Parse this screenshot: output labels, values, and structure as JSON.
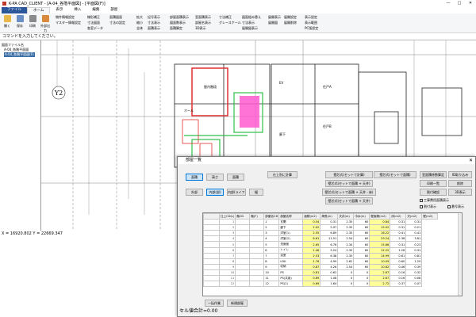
{
  "window": {
    "title": "K-PA CAD_CLIENT - [A-04_各階平面図] - [平面図(F)]",
    "controls": [
      "—",
      "□",
      "✕"
    ]
  },
  "tabs": [
    {
      "label": "ファイル",
      "type": "file"
    },
    {
      "label": "ホーム",
      "type": "active"
    },
    {
      "label": "表示",
      "type": "normal"
    },
    {
      "label": "挿入",
      "type": "normal"
    },
    {
      "label": "編集",
      "type": "normal"
    },
    {
      "label": "部屋",
      "type": "normal"
    }
  ],
  "ribbon": {
    "big_buttons": [
      "開く",
      "保存",
      "印刷",
      "外部出力"
    ],
    "small_buttons": [
      "物件情報設定",
      "マスター情報設定",
      "線形補正",
      "寸法図面",
      "各室データ",
      "面積図面",
      "寸法の設定",
      "拡大",
      "縮小",
      "全体",
      "記号表示",
      "寸法表示",
      "面積表示",
      "部屋面積表示",
      "図面数表示",
      "面積算定",
      "室面積表示",
      "部屋名表示",
      "3D表示",
      "グレースケール",
      "寸法補正",
      "図面組み替え",
      "寸法表示",
      "展開図表示",
      "展開表示",
      "展開図",
      "展開設定",
      "展開削除",
      "表示設定",
      "表示範囲",
      "PC版設定"
    ]
  },
  "command_bar": {
    "text": "コマンドを入力してください。"
  },
  "tree": {
    "items": [
      "図面ファイル名",
      "A-04_各階平面図",
      "A-04_各階平面図(F)"
    ]
  },
  "canvas": {
    "grid_label": "Y2",
    "room_labels": [
      "屋内階段",
      "EV",
      "住戸A",
      "住戸B",
      "ホール",
      "廊下"
    ]
  },
  "status": {
    "coords": "X = 16920.802 Y = 22669.347"
  },
  "dialog": {
    "title": "部屋一覧",
    "close": "✕",
    "mode_buttons": [
      "面積",
      "高さ",
      "面積"
    ],
    "type_buttons": [
      "外部",
      "内部(部)",
      "内部(ライフ)",
      "幅"
    ],
    "calc_buttons": [
      "仕上別に計算",
      "壁芯式(セットで計算)",
      "壁芯式(セットで面積)",
      "壁芯式(セットで面積 + 天井)",
      "壁芯式(セットで面積 + 天井 - 床)",
      "壁芯式(セットで面積 + 天井)"
    ],
    "right_buttons": [
      "室面積係数算定",
      "ID取り込み",
      "印刷一覧",
      "削除",
      "割付確認",
      "3D表示"
    ],
    "checkboxes": [
      "工事費用面積表示",
      "割付表示",
      "番号表示"
    ],
    "table": {
      "headers": [
        "仕上CD(L)",
        "階CD",
        "階(F)",
        "部屋名CD",
        "部屋名称",
        "面積(m2)",
        "周長(m)",
        "天井(m)",
        "巾木(m)",
        "壁面積(m2)",
        "床(m2)",
        "天(m2)",
        "壁(m2)"
      ],
      "rows": [
        [
          "1",
          "",
          "",
          "1",
          "玄関",
          "0.54",
          "0.31",
          "2.35",
          "60",
          "0.84",
          "0.31",
          "0.31"
        ],
        [
          "2",
          "",
          "",
          "2",
          "廊下",
          "2.02",
          "5.97",
          "2.35",
          "60",
          "15.02",
          "0.31",
          "0.21"
        ],
        [
          "3",
          "",
          "",
          "3",
          "洋室(1)",
          "2.55",
          "6.89",
          "2.35",
          "60",
          "16.22",
          "0.41",
          "0.41"
        ],
        [
          "4",
          "",
          "",
          "4",
          "洋室(2)",
          "6.61",
          "11.51",
          "2.54",
          "60",
          "29.24",
          "2.38",
          "3.61"
        ],
        [
          "5",
          "",
          "",
          "5",
          "洗面室",
          "2.65",
          "6.78",
          "2.34",
          "60",
          "15.86",
          "0.31",
          "0.23"
        ],
        [
          "6",
          "",
          "",
          "6",
          "トイレ",
          "1.46",
          "5.24",
          "2.35",
          "60",
          "12.22",
          "1.26",
          "0.31"
        ],
        [
          "7",
          "",
          "",
          "7",
          "浴室",
          "2.53",
          "6.38",
          "2.35",
          "60",
          "14.99",
          "0.61",
          "0.81"
        ],
        [
          "8",
          "",
          "",
          "8",
          "LDK",
          "1.76",
          "4.99",
          "2.62",
          "60",
          "10.09",
          "0.60",
          "1.29"
        ],
        [
          "9",
          "",
          "",
          "9",
          "収納",
          "0.87",
          "4.26",
          "2.54",
          "60",
          "10.82",
          "0.46",
          "0.39"
        ],
        [
          "10",
          "",
          "",
          "10",
          "PS",
          "0.81",
          "0.62",
          "0",
          "0",
          "2.67",
          "0.16",
          "0.32"
        ],
        [
          "11",
          "",
          "",
          "11",
          "PS(共用)",
          "0.69",
          "1.08",
          "0",
          "0",
          "2.67",
          "0.16",
          "0.08"
        ],
        [
          "12",
          "",
          "",
          "12",
          "PS(2)",
          "0.69",
          "1.64",
          "0",
          "0",
          "2.72",
          "0.37",
          "0.07"
        ]
      ]
    },
    "footer_buttons": [
      "一括作業",
      "新規部屋"
    ],
    "footer_total": "セル値合計=0.00"
  }
}
